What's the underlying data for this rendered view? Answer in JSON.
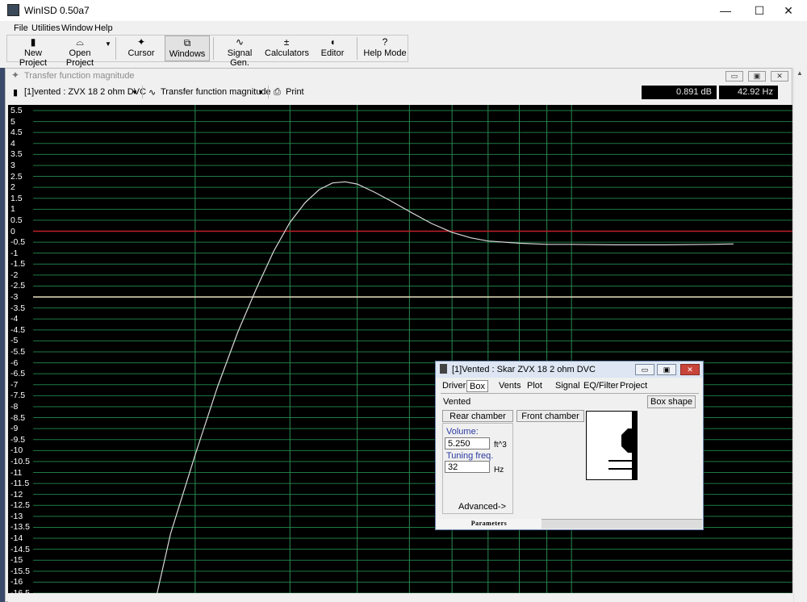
{
  "window": {
    "title": "WinISD 0.50a7",
    "controls": {
      "minimize": "—",
      "maximize": "☐",
      "close": "✕"
    }
  },
  "menu": [
    "File",
    "Utilities",
    "Window",
    "Help"
  ],
  "toolbar": [
    {
      "label": "New Project",
      "icon": "new-project-icon",
      "glyph": "▮"
    },
    {
      "label": "Open Project",
      "icon": "folder-open-icon",
      "glyph": "⌓"
    },
    {
      "label": "Cursor",
      "icon": "cursor-icon",
      "glyph": "✦"
    },
    {
      "label": "Windows",
      "icon": "windows-icon",
      "glyph": "⧉"
    },
    {
      "label": "Signal Gen.",
      "icon": "signal-gen-icon",
      "glyph": "∿"
    },
    {
      "label": "Calculators",
      "icon": "calculator-icon",
      "glyph": "±"
    },
    {
      "label": "Editor",
      "icon": "speaker-editor-icon",
      "glyph": "◖"
    },
    {
      "label": "Help Mode",
      "icon": "help-icon",
      "glyph": "?"
    }
  ],
  "plot_window": {
    "title": "Transfer function magnitude",
    "project_select": "[1]vented : ZVX 18 2 ohm DVC",
    "graph_select": "Transfer function magnitude",
    "print_label": "Print",
    "readout_db": "0.891 dB",
    "readout_hz": "42.92 Hz"
  },
  "chart_data": {
    "type": "line",
    "ylim": [
      -16.5,
      5.5
    ],
    "y_ticks": [
      "5.5",
      "5",
      "4.5",
      "4",
      "3.5",
      "3",
      "2.5",
      "2",
      "1.5",
      "1",
      "0.5",
      "0",
      "-0.5",
      "-1",
      "-1.5",
      "-2",
      "-2.5",
      "-3",
      "-3.5",
      "-4",
      "-4.5",
      "-5",
      "-5.5",
      "-6",
      "-6.5",
      "-7",
      "-7.5",
      "-8",
      "-8.5",
      "-9",
      "-9.5",
      "-10",
      "-10.5",
      "-11",
      "-11.5",
      "-12",
      "-12.5",
      "-13",
      "-13.5",
      "-14",
      "-14.5",
      "-15",
      "-15.5",
      "-16",
      "-16.5"
    ],
    "x_scale": "log",
    "xlim": [
      10,
      200
    ],
    "x_gridlines": [
      20,
      30,
      40,
      50,
      60,
      70,
      80,
      90,
      100
    ],
    "reference_lines": [
      {
        "y": 0,
        "color": "#c0202a"
      },
      {
        "y": -3,
        "color": "#e8e0c0"
      }
    ],
    "series": [
      {
        "color": "#d8d8d8",
        "x": [
          17,
          18,
          20,
          22,
          24,
          26,
          28,
          30,
          32,
          34,
          36,
          38,
          40,
          42.9,
          46,
          50,
          55,
          60,
          65,
          70,
          80,
          90,
          100,
          120,
          150,
          180,
          200
        ],
        "y": [
          -16.5,
          -13.8,
          -10.2,
          -7.1,
          -4.6,
          -2.6,
          -0.9,
          0.4,
          1.3,
          1.9,
          2.2,
          2.25,
          2.15,
          1.8,
          1.4,
          0.9,
          0.35,
          -0.05,
          -0.3,
          -0.45,
          -0.55,
          -0.6,
          -0.6,
          -0.62,
          -0.62,
          -0.6,
          -0.58
        ]
      }
    ],
    "grid": true
  },
  "dialog": {
    "title": "[1]Vented : Skar ZVX 18 2 ohm DVC",
    "tabs": [
      "Driver",
      "Box",
      "Vents",
      "Plot",
      "Signal",
      "EQ/Filter",
      "Project"
    ],
    "active_tab": "Box",
    "box_type": "Vented",
    "box_shape_button": "Box shape",
    "rear_chamber_button": "Rear chamber",
    "front_chamber_button": "Front chamber",
    "volume_label": "Volume:",
    "volume_value": "5.250",
    "volume_unit": "ft^3",
    "tuning_label": "Tuning freq.",
    "tuning_value": "32",
    "tuning_unit": "Hz",
    "advanced_button": "Advanced->",
    "status": "Parameters"
  }
}
